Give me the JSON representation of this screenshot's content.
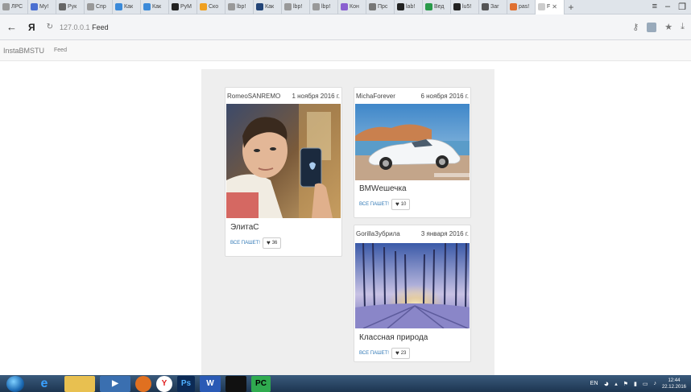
{
  "browser": {
    "tabs": [
      {
        "label": "ЛРС",
        "color": "#888"
      },
      {
        "label": "My!",
        "color": "#4a6fd1"
      },
      {
        "label": "Рук",
        "color": "#666"
      },
      {
        "label": "Спр",
        "color": "#888"
      },
      {
        "label": "Как",
        "color": "#3b8ad9"
      },
      {
        "label": "Как",
        "color": "#3b8ad9"
      },
      {
        "label": "PyM",
        "color": "#222"
      },
      {
        "label": "Ско",
        "color": "#f0a020"
      },
      {
        "label": "lbp!",
        "color": "#888"
      },
      {
        "label": "Как",
        "color": "#224477"
      },
      {
        "label": "lbp!",
        "color": "#888"
      },
      {
        "label": "lbp!",
        "color": "#888"
      },
      {
        "label": "Кон",
        "color": "#8a5fd0"
      },
      {
        "label": "Прс",
        "color": "#777"
      },
      {
        "label": "lab!",
        "color": "#222"
      },
      {
        "label": "Вед",
        "color": "#2a9a4a"
      },
      {
        "label": "lu5!",
        "color": "#222"
      },
      {
        "label": "Заг",
        "color": "#555"
      },
      {
        "label": "pas!",
        "color": "#e07030"
      }
    ],
    "active_tab": {
      "label": "F"
    },
    "url_host": "127.0.0.1",
    "url_path": "Feed"
  },
  "site": {
    "brand": "InstaBMSTU",
    "nav_feed": "Feed"
  },
  "posts": [
    {
      "author": "RomeoSANREMO",
      "date": "1 ноября 2016 г.",
      "caption": "ЭлитаС",
      "share_label": "ВСЕ ПАШЕТ!",
      "likes": "36",
      "image": "selfie"
    },
    {
      "author": "MichaForever",
      "date": "6 ноября 2016 г.",
      "caption": "BMWешечка",
      "share_label": "ВСЕ ПАШЕТ!",
      "likes": "10",
      "image": "car"
    },
    {
      "author": "GorillaЗубрила",
      "date": "3 января 2016 г.",
      "caption": "Классная природа",
      "share_label": "ВСЕ ПАШЕТ!",
      "likes": "23",
      "image": "forest"
    }
  ],
  "taskbar": {
    "apps": [
      "Ps",
      "W",
      "",
      "PC"
    ],
    "lang": "EN",
    "time": "12:44",
    "date": "22.12.2016"
  }
}
